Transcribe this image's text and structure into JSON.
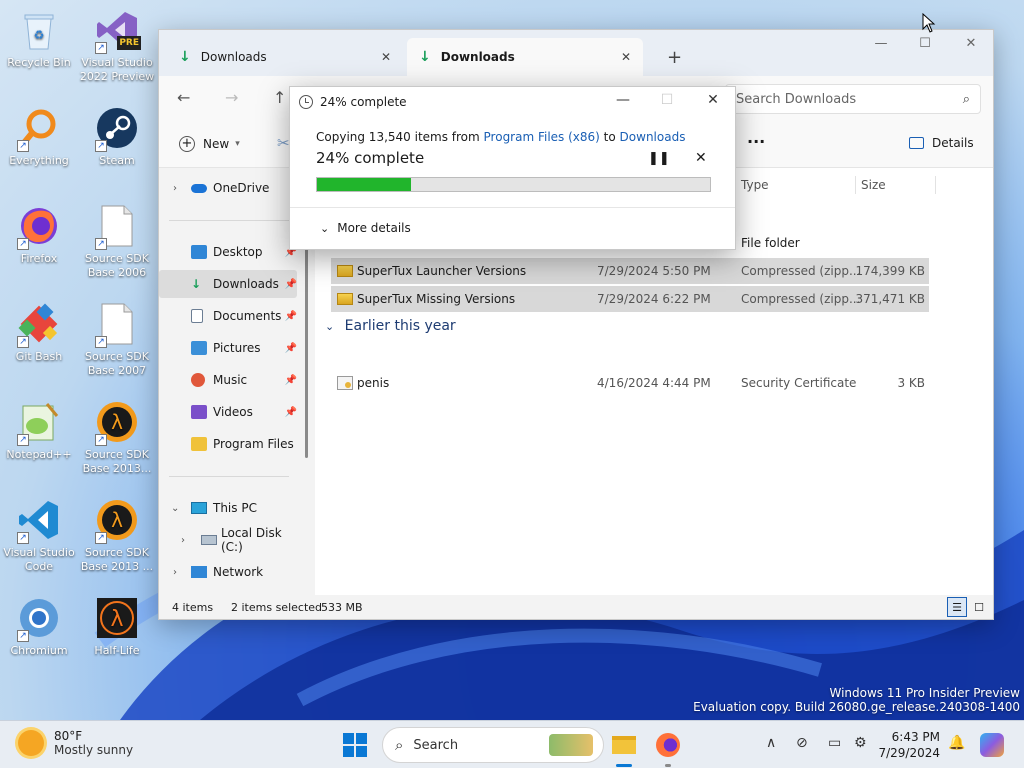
{
  "desktop": {
    "icons": [
      {
        "label": "Recycle Bin"
      },
      {
        "label": "Visual Studio 2022 Preview",
        "badge": "PRE"
      },
      {
        "label": "Everything"
      },
      {
        "label": "Steam"
      },
      {
        "label": "Firefox"
      },
      {
        "label": "Source SDK Base 2006"
      },
      {
        "label": "Git Bash"
      },
      {
        "label": "Source SDK Base 2007"
      },
      {
        "label": "Notepad++"
      },
      {
        "label": "Source SDK Base 2013..."
      },
      {
        "label": "Visual Studio Code"
      },
      {
        "label": "Source SDK Base 2013 ..."
      },
      {
        "label": "Chromium"
      },
      {
        "label": "Half-Life"
      }
    ],
    "watermark": {
      "line1": "Windows 11 Pro Insider Preview",
      "line2": "Evaluation copy. Build 26080.ge_release.240308-1400"
    }
  },
  "explorer": {
    "tabs": [
      {
        "label": "Downloads",
        "active": false
      },
      {
        "label": "Downloads",
        "active": true
      }
    ],
    "search_placeholder": "Search Downloads",
    "toolbar": {
      "new_label": "New",
      "details_label": "Details",
      "more_label": "···"
    },
    "sidebar": {
      "onedrive": "OneDrive",
      "quick_access": [
        {
          "label": "Desktop",
          "color": "#2f86d6"
        },
        {
          "label": "Downloads",
          "color": "#1a9f5a",
          "selected": true
        },
        {
          "label": "Documents",
          "color": "#6b7d93"
        },
        {
          "label": "Pictures",
          "color": "#3a8fd8"
        },
        {
          "label": "Music",
          "color": "#e0573a"
        },
        {
          "label": "Videos",
          "color": "#7a4fc9"
        },
        {
          "label": "Program Files",
          "color": "#f0c23a"
        }
      ],
      "this_pc": "This PC",
      "local_disk": "Local Disk (C:)",
      "network": "Network"
    },
    "columns": {
      "type": "Type",
      "size": "Size"
    },
    "rows_recent": [
      {
        "name": "",
        "date": "",
        "type": "File folder",
        "size": ""
      },
      {
        "name": "SuperTux Launcher Versions",
        "date": "7/29/2024 5:50 PM",
        "type": "Compressed (zipp...",
        "size": "174,399 KB"
      },
      {
        "name": "SuperTux Missing Versions",
        "date": "7/29/2024 6:22 PM",
        "type": "Compressed (zipp...",
        "size": "371,471 KB"
      }
    ],
    "group_earlier": "Earlier this year",
    "rows_earlier": [
      {
        "name": "penis",
        "date": "4/16/2024 4:44 PM",
        "type": "Security Certificate",
        "size": "3 KB"
      }
    ],
    "status": {
      "items": "4 items",
      "selected": "2 items selected",
      "size": "533 MB"
    }
  },
  "copy_dialog": {
    "title": "24% complete",
    "line_prefix": "Copying 13,540 items from ",
    "source": "Program Files (x86)",
    "line_mid": " to ",
    "destination": "Downloads",
    "percent_text": "24% complete",
    "progress": 0.24,
    "more_details": "More details"
  },
  "taskbar": {
    "temperature": "80°F",
    "condition": "Mostly sunny",
    "search_label": "Search",
    "time": "6:43 PM",
    "date": "7/29/2024"
  }
}
